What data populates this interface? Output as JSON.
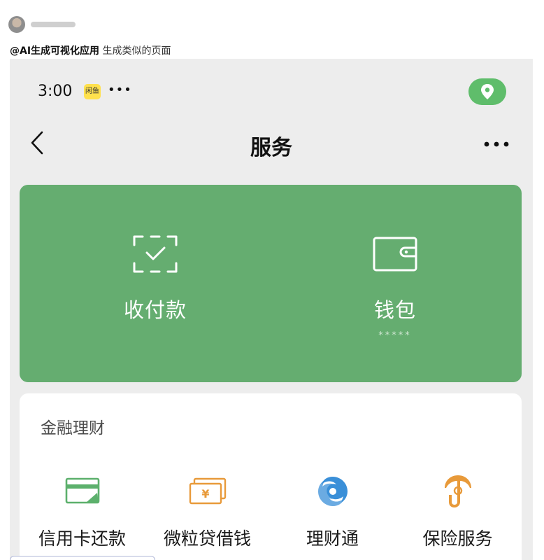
{
  "post": {
    "mention": "@AI生成可视化应用",
    "text": " 生成类似的页面"
  },
  "status_bar": {
    "time": "3:00",
    "app_badge": "闲鱼",
    "dots": "•••"
  },
  "nav": {
    "title": "服务",
    "more": "•••"
  },
  "green_card": {
    "collect_label": "收付款",
    "wallet_label": "钱包",
    "wallet_balance": "*****"
  },
  "finance": {
    "title": "金融理财",
    "items": [
      {
        "label": "信用卡还款",
        "icon": "credit-card-icon"
      },
      {
        "label": "微粒贷借钱",
        "icon": "loan-icon"
      },
      {
        "label": "理财通",
        "icon": "wealth-icon"
      },
      {
        "label": "保险服务",
        "icon": "insurance-icon"
      }
    ]
  },
  "colors": {
    "accent_green": "#65ad70",
    "location_green": "#5fbd6b",
    "icon_green": "#5cb06c",
    "icon_orange": "#e89a3a",
    "icon_blue": "#3a8fd8"
  }
}
